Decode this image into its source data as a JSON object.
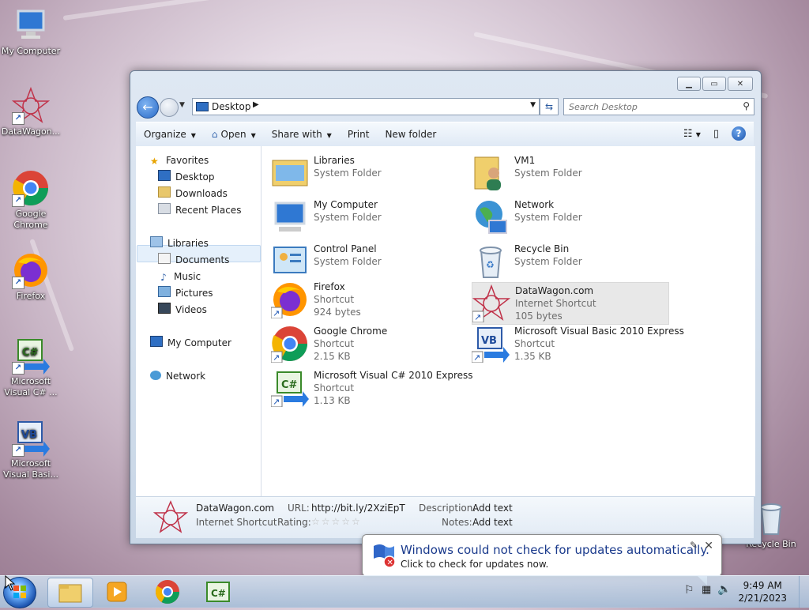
{
  "desktop": {
    "icons": [
      {
        "label": "My Computer"
      },
      {
        "label": "DataWagon..."
      },
      {
        "label": "Google Chrome"
      },
      {
        "label": "Firefox"
      },
      {
        "label": "Microsoft Visual C# ..."
      },
      {
        "label": "Microsoft Visual Basi..."
      },
      {
        "label": "Recycle Bin"
      }
    ]
  },
  "window": {
    "address": "Desktop",
    "search_placeholder": "Search Desktop",
    "toolbar": {
      "organize": "Organize",
      "open": "Open",
      "share_with": "Share with",
      "print": "Print",
      "new_folder": "New folder"
    },
    "nav": {
      "favorites": "Favorites",
      "desktop": "Desktop",
      "downloads": "Downloads",
      "recent_places": "Recent Places",
      "libraries": "Libraries",
      "documents": "Documents",
      "music": "Music",
      "pictures": "Pictures",
      "videos": "Videos",
      "my_computer": "My Computer",
      "network": "Network"
    },
    "items": [
      {
        "name": "Libraries",
        "type": "System Folder",
        "size": ""
      },
      {
        "name": "VM1",
        "type": "System Folder",
        "size": ""
      },
      {
        "name": "My Computer",
        "type": "System Folder",
        "size": ""
      },
      {
        "name": "Network",
        "type": "System Folder",
        "size": ""
      },
      {
        "name": "Control Panel",
        "type": "System Folder",
        "size": ""
      },
      {
        "name": "Recycle Bin",
        "type": "System Folder",
        "size": ""
      },
      {
        "name": "Firefox",
        "type": "Shortcut",
        "size": "924 bytes"
      },
      {
        "name": "DataWagon.com",
        "type": "Internet Shortcut",
        "size": "105 bytes"
      },
      {
        "name": "Google Chrome",
        "type": "Shortcut",
        "size": "2.15 KB"
      },
      {
        "name": "Microsoft Visual Basic 2010 Express",
        "type": "Shortcut",
        "size": "1.35 KB"
      },
      {
        "name": "Microsoft Visual C# 2010 Express",
        "type": "Shortcut",
        "size": "1.13 KB"
      }
    ],
    "details": {
      "name": "DataWagon.com",
      "type": "Internet Shortcut",
      "url_label": "URL:",
      "url_value": "http://bit.ly/2XziEpT",
      "rating_label": "Rating:",
      "rating_value": 0,
      "rating_max": 5,
      "description_label": "Description:",
      "description_value": "Add text",
      "notes_label": "Notes:",
      "notes_value": "Add text"
    }
  },
  "balloon": {
    "title": "Windows could not check for updates automatically.",
    "body": "Click to check for updates now."
  },
  "taskbar": {
    "time": "9:49 AM",
    "date": "2/21/2023"
  }
}
